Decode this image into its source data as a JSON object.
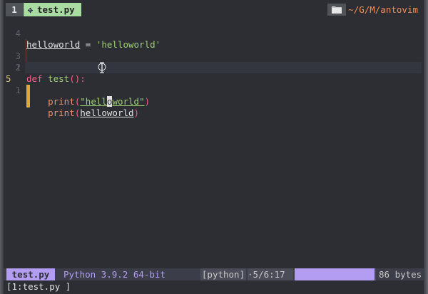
{
  "tabline": {
    "tab_number": "1",
    "tab_label": "test.py",
    "tab_icon": "python-icon",
    "folder_icon": "folder-icon",
    "cwd": "~/G/M/antovim"
  },
  "editor": {
    "lines": [
      {
        "num": "4",
        "text_var": "helloworld",
        "text_eq": " = ",
        "text_str": "'helloworld'"
      },
      {
        "num": "3"
      },
      {
        "num": "2"
      },
      {
        "num": "1",
        "kw": "def",
        "fname": "test",
        "rest": "():"
      },
      {
        "num": "5",
        "indent": "    ",
        "call": "print",
        "open": "(",
        "str_a": "\"hel",
        "str_b": "l",
        "str_c": "o",
        "str_d": "world\"",
        "close": ")"
      },
      {
        "num": "1",
        "indent": "    ",
        "call": "print",
        "open": "(",
        "arg": "helloworld",
        "close": ")"
      }
    ]
  },
  "statusline": {
    "file": "test.py",
    "python": "Python 3.9.2 64-bit",
    "filetype": "[python]",
    "position": "·5/6:17",
    "progress_fraction": 0.98,
    "size": "86 bytes"
  },
  "cmdline": {
    "text": "[1:test.py ]"
  },
  "colors": {
    "background": "#2c2e34",
    "tab_active": "#a9dca0",
    "accent_purple": "#b39df3",
    "cwd_orange": "#f28b54",
    "git_sign_orange": "#e6a23c"
  }
}
